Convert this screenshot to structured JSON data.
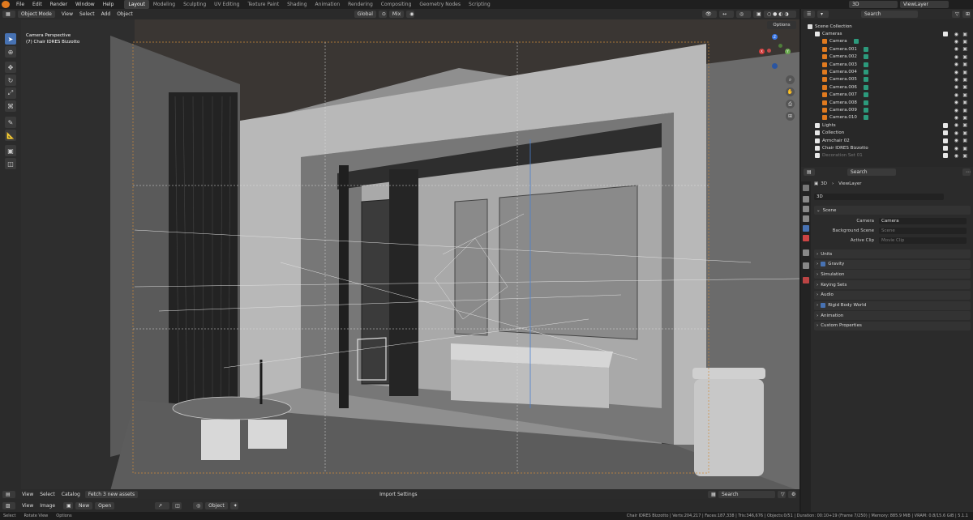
{
  "topbar": {
    "menus": [
      "File",
      "Edit",
      "Render",
      "Window",
      "Help"
    ],
    "workspaces": [
      "Layout",
      "Modeling",
      "Sculpting",
      "UV Editing",
      "Texture Paint",
      "Shading",
      "Animation",
      "Rendering",
      "Compositing",
      "Geometry Nodes",
      "Scripting"
    ],
    "active_workspace": "Layout",
    "scene": "3D",
    "view_layer": "ViewLayer"
  },
  "viewport_header": {
    "mode": "Object Mode",
    "menus": [
      "View",
      "Select",
      "Add",
      "Object"
    ],
    "orientation": "Global",
    "proportional": "Mix"
  },
  "viewport": {
    "info_line1": "Camera Perspective",
    "info_line2": "(7) Chair IDRES Bizzotto",
    "options_label": "Options",
    "gizmo_x": "X",
    "gizmo_y": "Y",
    "gizmo_z": "Z"
  },
  "asset_bar": {
    "menus": [
      "View",
      "Select",
      "Catalog"
    ],
    "fetch_label": "Fetch 3 new assets",
    "import_label": "Import Settings",
    "search_placeholder": "Search"
  },
  "image_bar": {
    "menus": [
      "View",
      "Image"
    ],
    "new_label": "New",
    "open_label": "Open",
    "object_label": "Object"
  },
  "status": {
    "left": [
      "Select",
      "Rotate View",
      "Options"
    ],
    "right": "Chair IDRES Bizzotto | Verts:204,217 | Faces:187,338 | Tris:346,676 | Objects:0/51 | Duration: 00:10+19 (Frame 7/250) | Memory: 885.9 MiB | VRAM: 0.8/15.6 GiB | 5.1.1"
  },
  "outliner": {
    "search_placeholder": "Search",
    "items": [
      {
        "label": "Scene Collection",
        "indent": 0,
        "kind": "scene"
      },
      {
        "label": "Cameras",
        "indent": 1,
        "kind": "collection"
      },
      {
        "label": "Camera",
        "indent": 2,
        "kind": "camera"
      },
      {
        "label": "Camera.001",
        "indent": 2,
        "kind": "camera"
      },
      {
        "label": "Camera.002",
        "indent": 2,
        "kind": "camera"
      },
      {
        "label": "Camera.003",
        "indent": 2,
        "kind": "camera"
      },
      {
        "label": "Camera.004",
        "indent": 2,
        "kind": "camera"
      },
      {
        "label": "Camera.005",
        "indent": 2,
        "kind": "camera"
      },
      {
        "label": "Camera.006",
        "indent": 2,
        "kind": "camera"
      },
      {
        "label": "Camera.007",
        "indent": 2,
        "kind": "camera"
      },
      {
        "label": "Camera.008",
        "indent": 2,
        "kind": "camera"
      },
      {
        "label": "Camera.009",
        "indent": 2,
        "kind": "camera"
      },
      {
        "label": "Camera.010",
        "indent": 2,
        "kind": "camera"
      },
      {
        "label": "Lights",
        "indent": 1,
        "kind": "collection"
      },
      {
        "label": "Collection",
        "indent": 1,
        "kind": "collection"
      },
      {
        "label": "Armchair 02",
        "indent": 1,
        "kind": "collection"
      },
      {
        "label": "Chair IDRES Bizzotto",
        "indent": 1,
        "kind": "collection"
      },
      {
        "label": "Decoration Set 01",
        "indent": 1,
        "kind": "collection"
      }
    ]
  },
  "properties": {
    "search_placeholder": "Search",
    "breadcrumb_scene": "3D",
    "breadcrumb_layer": "ViewLayer",
    "scene_name": "3D",
    "scene_panel": "Scene",
    "camera_label": "Camera",
    "camera_value": "Camera",
    "bg_scene_label": "Background Scene",
    "bg_scene_value": "Scene",
    "active_clip_label": "Active Clip",
    "active_clip_value": "Movie Clip",
    "panels": [
      "Units",
      "Gravity",
      "Simulation",
      "Keying Sets",
      "Audio",
      "Rigid Body World",
      "Animation",
      "Custom Properties"
    ]
  },
  "colors": {
    "accent": "#4772b3",
    "camera_icon": "#e07a1f",
    "camera_data": "#2c9a7c"
  }
}
